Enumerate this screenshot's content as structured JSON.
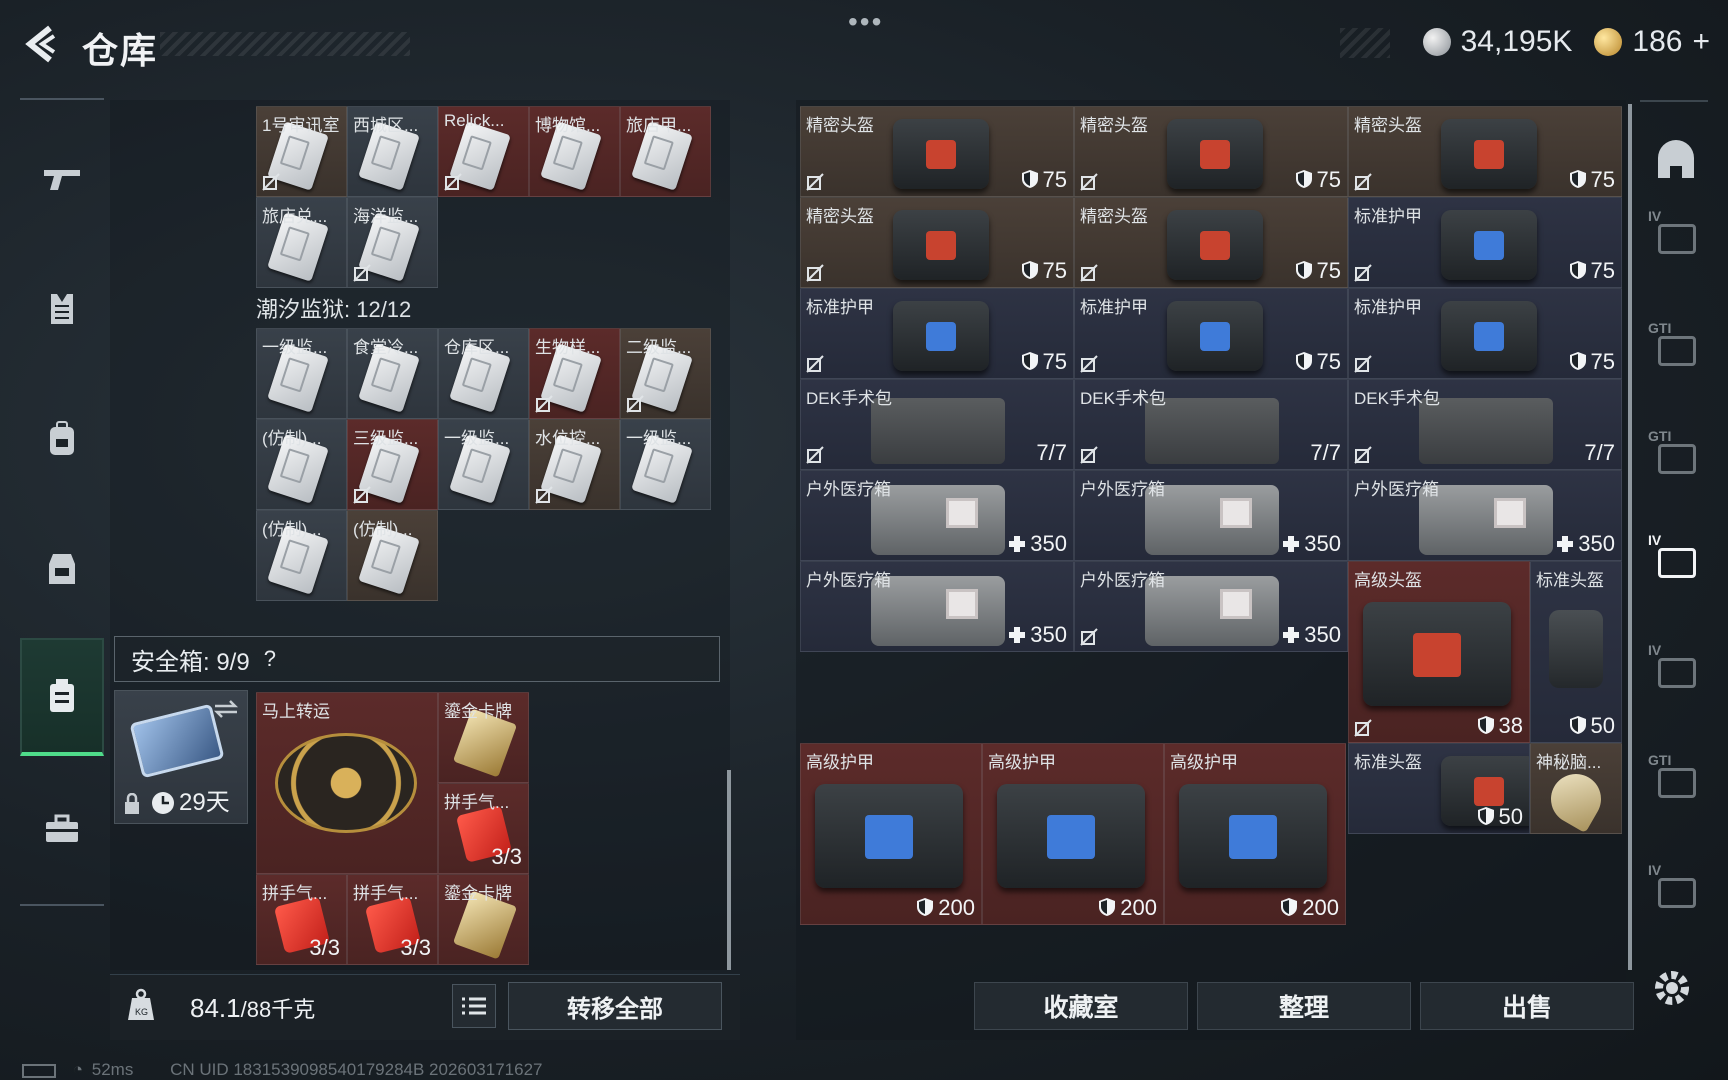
{
  "header": {
    "title": "仓库",
    "menu_dots": "•••",
    "currency1": "34,195K",
    "currency2": "186",
    "currency2_add": "+",
    "currency1_icon": "silver-coin-icon",
    "currency2_icon": "gold-coin-icon"
  },
  "nav": {
    "items": [
      "weapon-icon",
      "vest-icon",
      "backpack-icon",
      "chest-rig-icon",
      "safe-box-icon",
      "briefcase-icon"
    ],
    "active": "safe-box-icon",
    "accent": "#4fdc8a"
  },
  "keycards_top": [
    {
      "label": "1号审讯室",
      "bg": "brown"
    },
    {
      "label": "西城区...",
      "bg": "gray"
    },
    {
      "label": "Relick...",
      "bg": "red"
    },
    {
      "label": "博物馆...",
      "bg": "red"
    },
    {
      "label": "旅店甲...",
      "bg": "red"
    },
    {
      "label": "旅店兑...",
      "bg": "gray"
    },
    {
      "label": "海洋监...",
      "bg": "gray"
    }
  ],
  "section_title": "潮汐监狱: 12/12",
  "keycards_prison": [
    {
      "label": "一级监...",
      "bg": "gray"
    },
    {
      "label": "食堂冷...",
      "bg": "gray"
    },
    {
      "label": "仓库区...",
      "bg": "gray"
    },
    {
      "label": "生物样...",
      "bg": "red"
    },
    {
      "label": "二级监...",
      "bg": "brown"
    },
    {
      "label": "(仿制)...",
      "bg": "gray"
    },
    {
      "label": "三级监...",
      "bg": "red"
    },
    {
      "label": "一级监...",
      "bg": "gray"
    },
    {
      "label": "水位控...",
      "bg": "brown"
    },
    {
      "label": "一级监...",
      "bg": "gray"
    },
    {
      "label": "(仿制)...",
      "bg": "gray"
    },
    {
      "label": "(仿制)...",
      "bg": "brown"
    }
  ],
  "safebox": {
    "title": "安全箱: 9/9",
    "help": "?",
    "duration": "29天"
  },
  "safe_items": [
    {
      "label": "马上转运",
      "value": ""
    },
    {
      "label": "鎏金卡牌",
      "value": ""
    },
    {
      "label": "拼手气...",
      "value": "3/3"
    },
    {
      "label": "拼手气...",
      "value": "3/3"
    },
    {
      "label": "拼手气...",
      "value": "3/3"
    },
    {
      "label": "鎏金卡牌",
      "value": ""
    }
  ],
  "footer_left": {
    "weight": "84.1",
    "weight_max": "/88千克",
    "transfer_all": "转移全部"
  },
  "status_bar": {
    "ping": "52ms",
    "uid": "CN UID 1831539098540179284B 202603171627"
  },
  "warehouse": [
    {
      "label": "精密头盔",
      "value": "75"
    },
    {
      "label": "精密头盔",
      "value": "75"
    },
    {
      "label": "精密头盔",
      "value": "75"
    },
    {
      "label": "精密头盔",
      "value": "75"
    },
    {
      "label": "精密头盔",
      "value": "75"
    },
    {
      "label": "标准护甲",
      "value": "75"
    },
    {
      "label": "标准护甲",
      "value": "75"
    },
    {
      "label": "标准护甲",
      "value": "75"
    },
    {
      "label": "标准护甲",
      "value": "75"
    },
    {
      "label": "DEK手术包",
      "value": "7/7"
    },
    {
      "label": "DEK手术包",
      "value": "7/7"
    },
    {
      "label": "DEK手术包",
      "value": "7/7"
    },
    {
      "label": "户外医疗箱",
      "value": "350"
    },
    {
      "label": "户外医疗箱",
      "value": "350"
    },
    {
      "label": "户外医疗箱",
      "value": "350"
    },
    {
      "label": "户外医疗箱",
      "value": "350"
    },
    {
      "label": "户外医疗箱",
      "value": "350"
    },
    {
      "label": "高级头盔",
      "value": "38"
    },
    {
      "label": "标准头盔",
      "value": "50"
    },
    {
      "label": "高级护甲",
      "value": "200"
    },
    {
      "label": "高级护甲",
      "value": "200"
    },
    {
      "label": "高级护甲",
      "value": "200"
    },
    {
      "label": "标准头盔",
      "value": "50"
    },
    {
      "label": "神秘脑...",
      "value": ""
    }
  ],
  "right_sidebar": [
    "helmet-slot-icon",
    "IV",
    "GTI",
    "GTI",
    "IV",
    "IV",
    "GTI",
    "IV"
  ],
  "buttons": {
    "collection": "收藏室",
    "organize": "整理",
    "sell": "出售"
  }
}
